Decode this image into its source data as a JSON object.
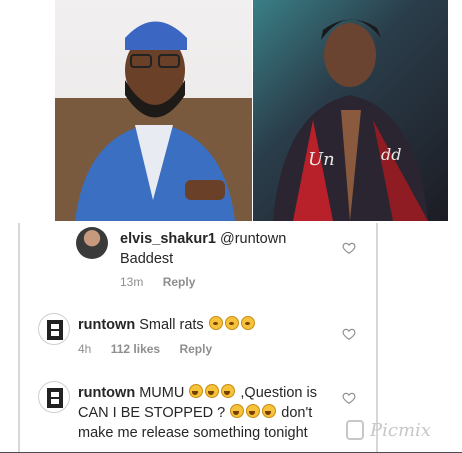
{
  "comments": [
    {
      "username": "elvis_shakur1",
      "body_line1": "@runtown",
      "body_line2": "Baddest",
      "time": "13m",
      "reply": "Reply"
    },
    {
      "username": "runtown",
      "body": "Small rats",
      "time": "4h",
      "likes": "112 likes",
      "reply": "Reply"
    },
    {
      "username": "runtown",
      "body_a": "MUMU",
      "body_b": ",Question is",
      "body_line2_a": "CAN I BE STOPPED ?",
      "body_line2_b": "don't",
      "body_line3": "make me release something tonight"
    }
  ],
  "watermark": "Picmix",
  "colors": {
    "heart": "#8e8e8e",
    "text": "#262626",
    "meta": "#8e8e8e"
  },
  "icons": [
    "heart-icon",
    "runtown-logo-icon",
    "laughing-emoji",
    "surprised-emoji"
  ]
}
